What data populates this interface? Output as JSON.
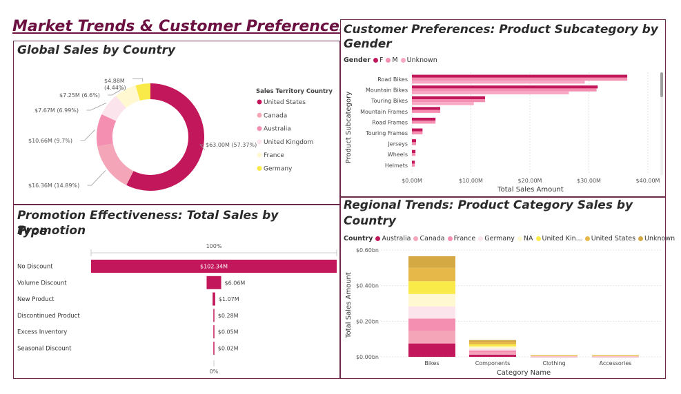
{
  "page_title": "Market Trends & Customer Preferences",
  "charts": {
    "global": {
      "title": "Global Sales by Country",
      "legend_title": "Sales Territory Country"
    },
    "gender": {
      "title_line1": "Customer Preferences: Product Subcategory by",
      "title_line2": "Gender",
      "legend_title": "Gender"
    },
    "promotion": {
      "title_line1": "Promotion Effectiveness: Total Sales by Promotion",
      "title_line2": "Type",
      "top_label": "100%",
      "bottom_label": "0%"
    },
    "regional": {
      "title_line1": "Regional Trends: Product Category Sales by",
      "title_line2": "Country",
      "legend_title": "Country"
    }
  },
  "chart_data": [
    {
      "type": "pie",
      "title": "Global Sales by Country",
      "legend_title": "Sales Territory Country",
      "slices": [
        {
          "label": "United States",
          "value": 63.0,
          "text": "$63.00M (57.37%)",
          "color": "#c2185b"
        },
        {
          "label": "Canada",
          "value": 16.36,
          "text": "$16.36M (14.89%)",
          "color": "#f4a6b8"
        },
        {
          "label": "Australia",
          "value": 10.66,
          "text": "$10.66M (9.7%)",
          "color": "#f48fb1"
        },
        {
          "label": "United Kingdom",
          "value": 7.67,
          "text": "$7.67M (6.99%)",
          "color": "#fce4ec"
        },
        {
          "label": "France",
          "value": 7.25,
          "text": "$7.25M (6.6%)",
          "color": "#fff8d0"
        },
        {
          "label": "Germany",
          "value": 4.88,
          "text_line1": "$4.88M",
          "text_line2": "(4.44%)",
          "color": "#f9ea4a"
        }
      ]
    },
    {
      "type": "bar",
      "orientation": "horizontal",
      "title": "Customer Preferences: Product Subcategory by Gender",
      "xlabel": "Total Sales Amount",
      "ylabel": "Product Subcategory",
      "xlim": [
        0,
        40
      ],
      "xticks": [
        "$0.00M",
        "$10.00M",
        "$20.00M",
        "$30.00M",
        "$40.00M"
      ],
      "categories": [
        "Road Bikes",
        "Mountain Bikes",
        "Touring Bikes",
        "Mountain Frames",
        "Road Frames",
        "Touring Frames",
        "Jerseys",
        "Wheels",
        "Helmets"
      ],
      "series": [
        {
          "name": "F",
          "color": "#c2185b",
          "values": [
            36.5,
            31.5,
            12.4,
            4.8,
            4.0,
            1.8,
            0.7,
            0.6,
            0.5
          ]
        },
        {
          "name": "M",
          "color": "#f48fb1",
          "values": [
            36.5,
            31.3,
            12.4,
            4.8,
            4.0,
            1.8,
            0.7,
            0.6,
            0.5
          ]
        },
        {
          "name": "Unknown",
          "color": "#f8a8c4",
          "values": [
            29.3,
            26.6,
            10.5,
            0,
            0,
            0,
            0,
            0,
            0
          ]
        }
      ]
    },
    {
      "type": "bar",
      "orientation": "horizontal",
      "title": "Promotion Effectiveness: Total Sales by Promotion Type",
      "categories": [
        "No Discount",
        "Volume Discount",
        "New Product",
        "Discontinued Product",
        "Excess Inventory",
        "Seasonal Discount"
      ],
      "values": [
        102.34,
        6.06,
        1.07,
        0.28,
        0.05,
        0.02
      ],
      "labels": [
        "$102.34M",
        "$6.06M",
        "$1.07M",
        "$0.28M",
        "$0.05M",
        "$0.02M"
      ],
      "color": "#c2185b"
    },
    {
      "type": "bar",
      "stacked": true,
      "title": "Regional Trends: Product Category Sales by Country",
      "xlabel": "Category Name",
      "ylabel": "Total Sales Amount",
      "ylim": [
        0,
        0.6
      ],
      "yticks": [
        "$0.00bn",
        "$0.20bn",
        "$0.40bn",
        "$0.60bn"
      ],
      "categories": [
        "Bikes",
        "Components",
        "Clothing",
        "Accessories"
      ],
      "series": [
        {
          "name": "Australia",
          "color": "#c2185b",
          "values": [
            0.075,
            0.012,
            0.001,
            0.001
          ]
        },
        {
          "name": "Canada",
          "color": "#f4a6b8",
          "values": [
            0.072,
            0.012,
            0.001,
            0.001
          ]
        },
        {
          "name": "France",
          "color": "#f48fb1",
          "values": [
            0.068,
            0.012,
            0.001,
            0.001
          ]
        },
        {
          "name": "Germany",
          "color": "#fce4ec",
          "values": [
            0.068,
            0.011,
            0.001,
            0.001
          ]
        },
        {
          "name": "NA",
          "color": "#fff8d0",
          "values": [
            0.07,
            0.011,
            0.001,
            0.001
          ]
        },
        {
          "name": "United Kin...",
          "color": "#f9ea4a",
          "values": [
            0.072,
            0.012,
            0.001,
            0.001
          ]
        },
        {
          "name": "United States",
          "color": "#e6b84a",
          "values": [
            0.075,
            0.012,
            0.001,
            0.001
          ]
        },
        {
          "name": "Unknown",
          "color": "#d4a843",
          "values": [
            0.065,
            0.012,
            0.002,
            0.002
          ]
        }
      ]
    }
  ]
}
